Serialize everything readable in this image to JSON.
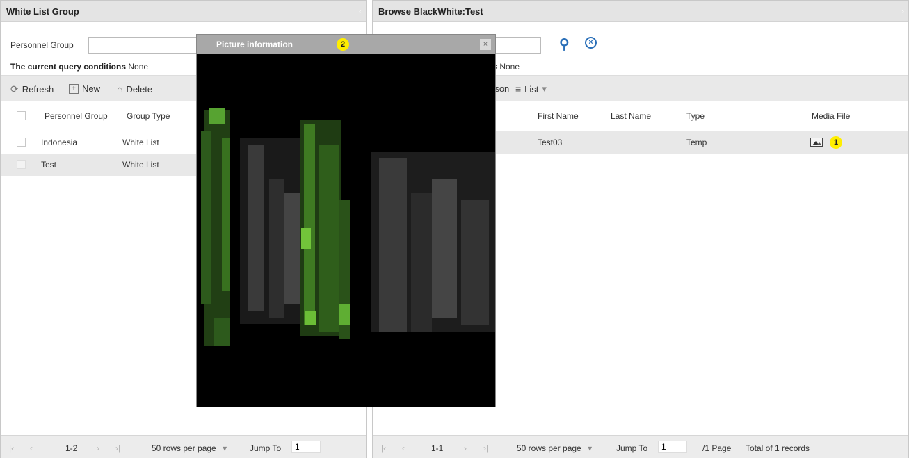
{
  "left_panel": {
    "title": "White List Group",
    "query_label": "Personnel Group",
    "query_value": "",
    "conditions_label": "The current query conditions",
    "conditions_value": "None",
    "toolbar": {
      "refresh": "Refresh",
      "new": "New",
      "delete": "Delete"
    },
    "columns": [
      "Personnel Group",
      "Group Type"
    ],
    "rows": [
      {
        "group": "Indonesia",
        "type": "White List"
      },
      {
        "group": "Test",
        "type": "White List"
      }
    ],
    "footer": {
      "range": "1-2",
      "rows_per_page": "50 rows per page",
      "jump_label": "Jump To",
      "jump_value": "1"
    }
  },
  "right_panel": {
    "title": "Browse BlackWhite:Test",
    "conditions_partial": "s None",
    "toolbar": {
      "person_partial": "rson",
      "list": "List"
    },
    "columns": [
      "First Name",
      "Last Name",
      "Type",
      "Media File"
    ],
    "rows": [
      {
        "first_name": "Test03",
        "last_name": "",
        "type": "Temp",
        "media": "image-icon"
      }
    ],
    "footer": {
      "range": "1-1",
      "rows_per_page": "50 rows per page",
      "jump_label": "Jump To",
      "jump_value": "1",
      "pages": "/1 Page",
      "total": "Total of 1 records"
    }
  },
  "modal": {
    "title": "Picture information",
    "close": "×"
  },
  "annotations": {
    "media_badge": "1",
    "modal_badge": "2"
  },
  "colors": {
    "highlight_row": "#e8e8e8",
    "badge": "#ffee00",
    "search_icon": "#2a6fb8"
  }
}
